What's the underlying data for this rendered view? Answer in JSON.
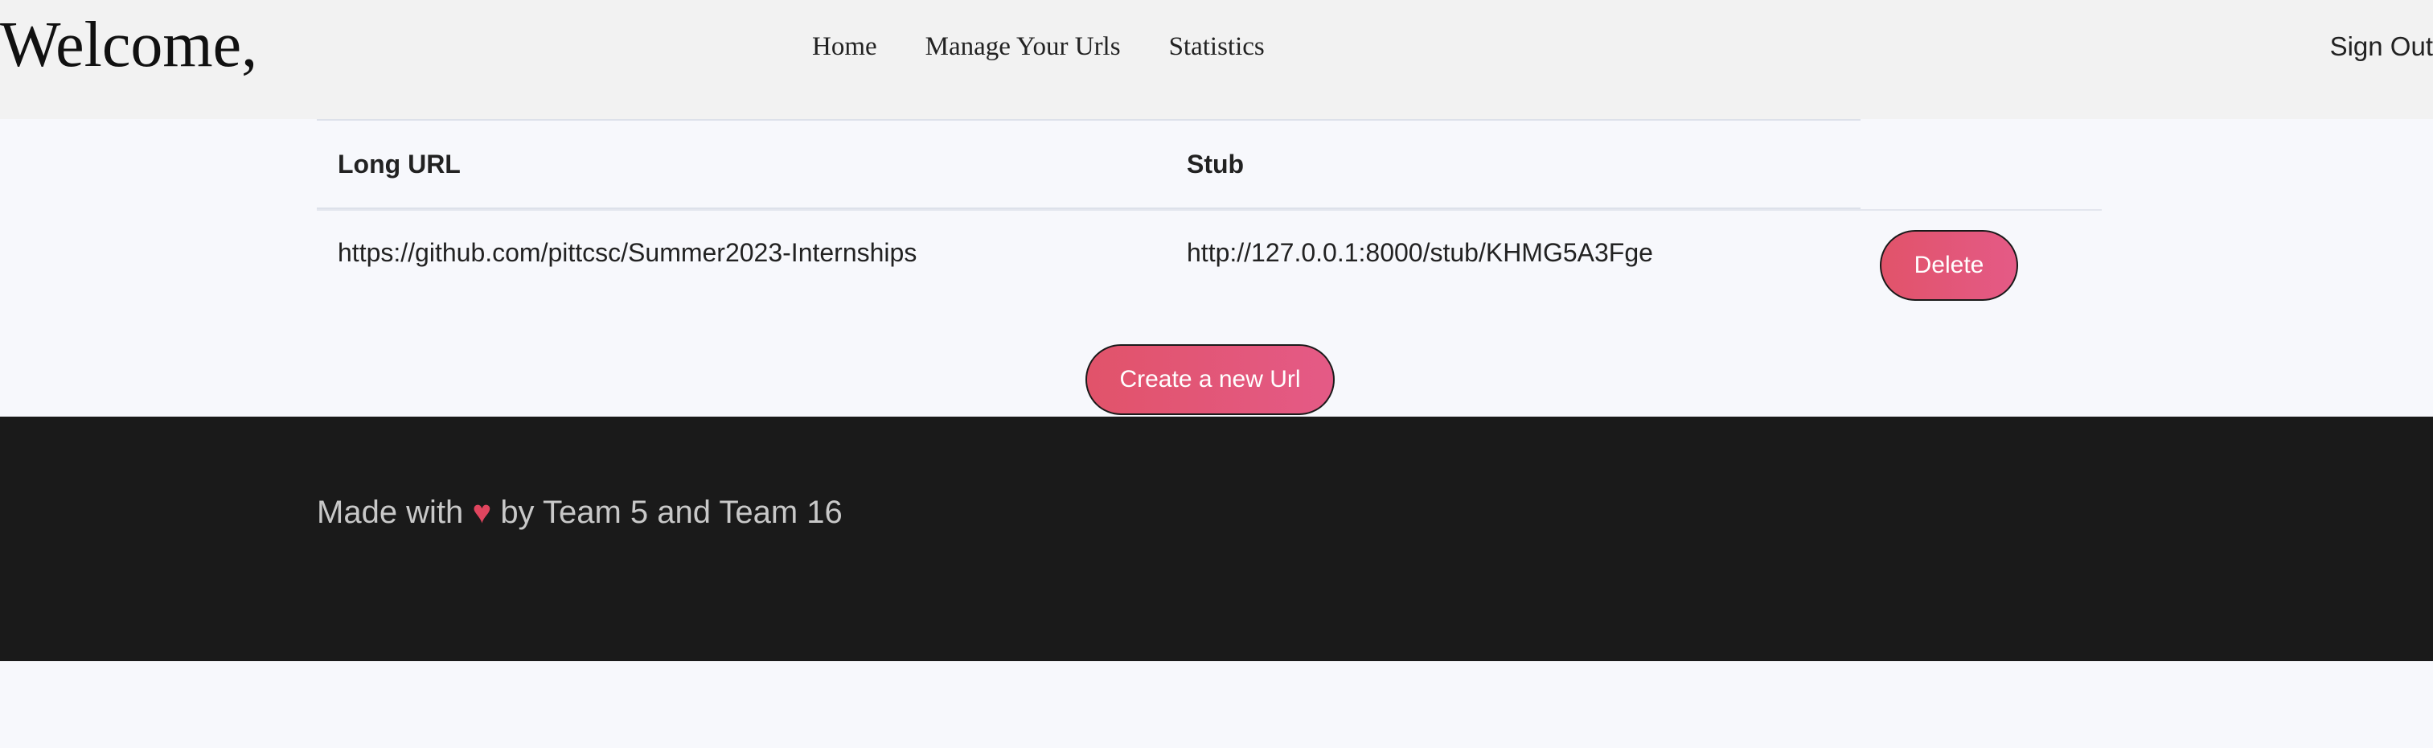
{
  "header": {
    "welcome": "Welcome,",
    "nav": [
      {
        "label": "Home"
      },
      {
        "label": "Manage Your Urls"
      },
      {
        "label": "Statistics"
      }
    ],
    "sign_out": "Sign Out"
  },
  "table": {
    "columns": [
      "Long URL",
      "Stub"
    ],
    "rows": [
      {
        "long_url": "https://github.com/pittcsc/Summer2023-Internships",
        "stub": "http://127.0.0.1:8000/stub/KHMG5A3Fge",
        "action": "Delete"
      }
    ]
  },
  "create_button": "Create a new Url",
  "footer": {
    "before": "Made with",
    "heart": "♥",
    "after": "by Team 5 and Team 16"
  },
  "colors": {
    "header_bg": "#f2f2f2",
    "page_bg": "#f7f8fc",
    "footer_bg": "#1a1a1a",
    "button_gradient_start": "#e1536a",
    "button_gradient_end": "#e45a86",
    "heart": "#e0455e"
  },
  "icons": [
    "heart-icon"
  ]
}
